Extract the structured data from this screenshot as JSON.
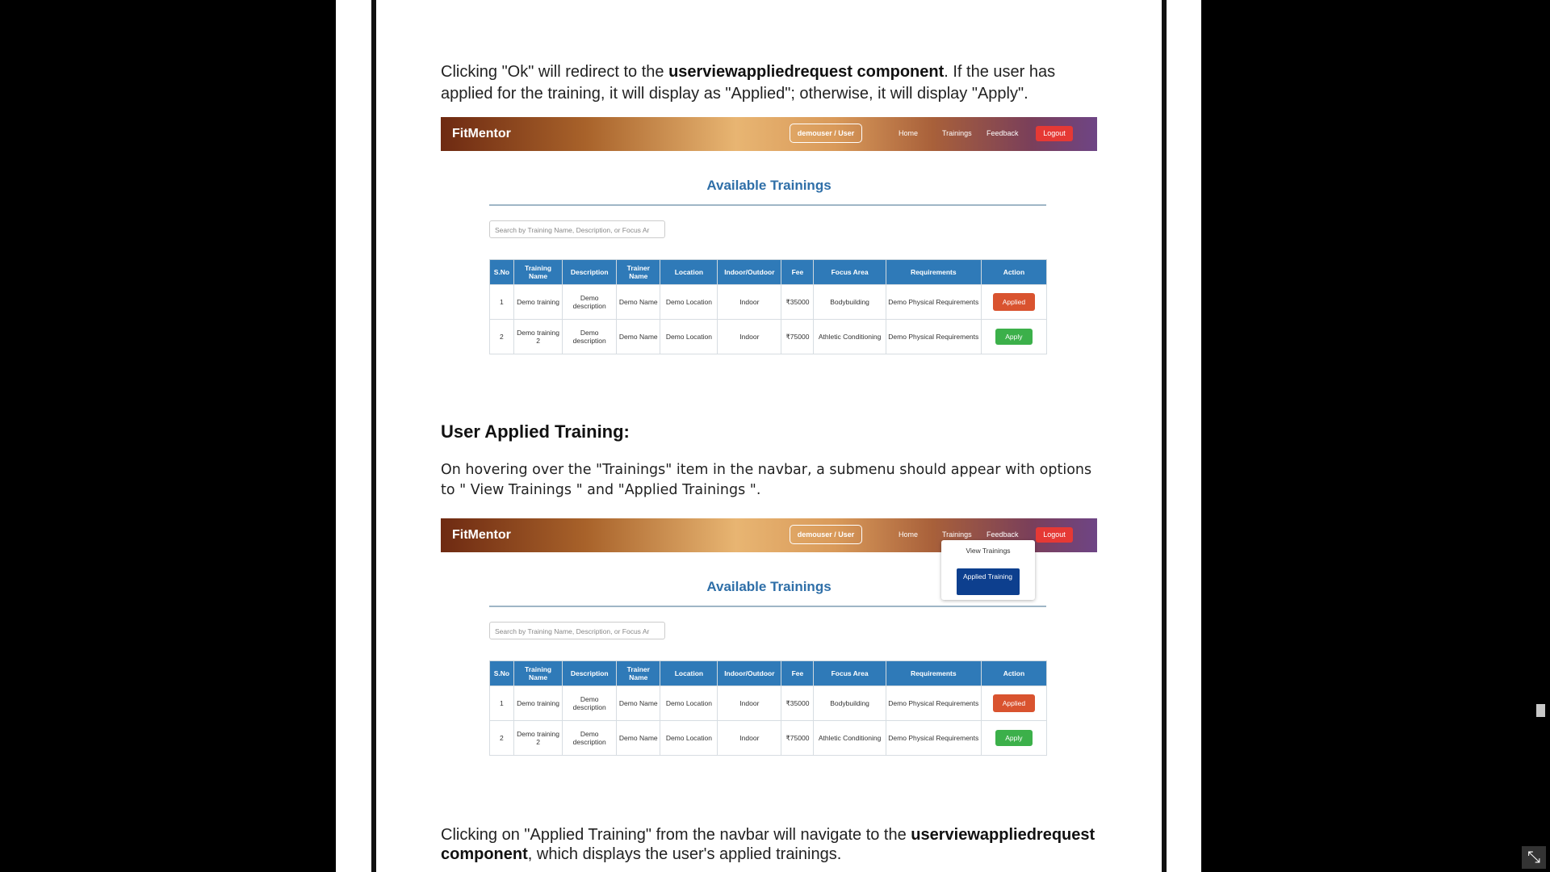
{
  "doc": {
    "p1_a": "Clicking \"Ok\" will redirect to the ",
    "p1_b": "userviewappliedrequest component",
    "p1_c": ". If the user has applied for the training, it will display as \"Applied\"; otherwise, it will display \"Apply\".",
    "section_heading": "User Applied Training:",
    "p2": "On hovering over the \"Trainings\" item in the navbar, a submenu should appear with options to \" View Trainings \" and \"Applied Trainings \".",
    "p3_a": "Clicking on \"Applied Training\" from the navbar will navigate to the ",
    "p3_b": "userviewappliedrequest component",
    "p3_c": ", which displays the user's applied trainings."
  },
  "shot": {
    "brand": "FitMentor",
    "user_pill": "demouser / User",
    "nav": {
      "home": "Home",
      "trainings": "Trainings",
      "feedback": "Feedback",
      "logout": "Logout"
    },
    "title": "Available Trainings",
    "search_placeholder": "Search by Training Name, Description, or Focus Ar",
    "headers": [
      "S.No",
      "Training Name",
      "Description",
      "Trainer Name",
      "Location",
      "Indoor/Outdoor",
      "Fee",
      "Focus Area",
      "Requirements",
      "Action"
    ],
    "rows": [
      {
        "sno": "1",
        "name": "Demo training",
        "desc": "Demo description",
        "trainer": "Demo Name",
        "location": "Demo Location",
        "io": "Indoor",
        "fee": "₹35000",
        "focus": "Bodybuilding",
        "req": "Demo Physical Requirements",
        "action": "Applied"
      },
      {
        "sno": "2",
        "name": "Demo training 2",
        "desc": "Demo description",
        "trainer": "Demo Name",
        "location": "Demo Location",
        "io": "Indoor",
        "fee": "₹75000",
        "focus": "Athletic Conditioning",
        "req": "Demo Physical Requirements",
        "action": "Apply"
      }
    ],
    "submenu": {
      "view": "View Trainings",
      "applied": "Applied Training"
    }
  },
  "colors": {
    "navbar_start": "#6e2a12",
    "navbar_end": "#6e4585",
    "table_header": "#2f7ab8",
    "applied_btn": "#d9532f",
    "apply_btn": "#3cb04a",
    "title": "#2f6fa8"
  },
  "icons": {
    "fullscreen": "exit-fullscreen-icon"
  }
}
